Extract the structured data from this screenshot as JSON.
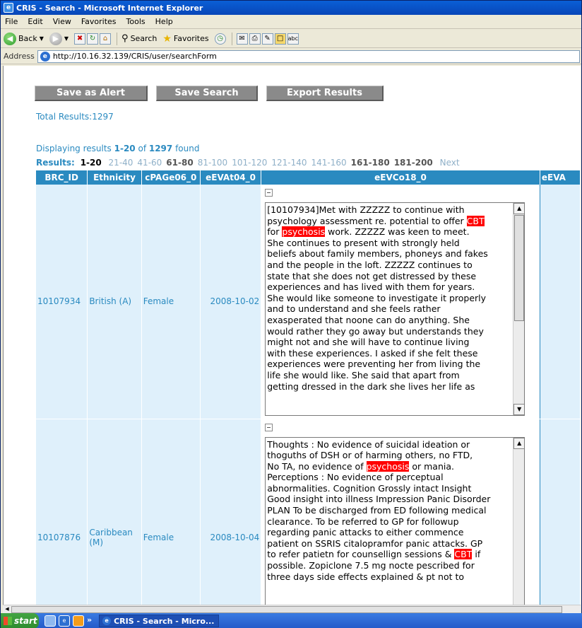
{
  "window": {
    "title": "CRIS - Search - Microsoft Internet Explorer"
  },
  "menu": [
    "File",
    "Edit",
    "View",
    "Favorites",
    "Tools",
    "Help"
  ],
  "toolbar": {
    "back": "Back",
    "search": "Search",
    "favorites": "Favorites"
  },
  "address": {
    "label": "Address",
    "url": "http://10.16.32.139/CRIS/user/searchForm"
  },
  "actions": {
    "alert": "Save as Alert",
    "save": "Save Search",
    "export": "Export Results"
  },
  "summary": {
    "total": "Total Results:1297",
    "displaying_pre": "Displaying results ",
    "displaying_range": "1-20",
    "displaying_of": " of ",
    "displaying_count": "1297",
    "displaying_post": " found"
  },
  "pager": {
    "label": "Results:",
    "current": "1-20",
    "pages": [
      "21-40",
      "41-60",
      "61-80",
      "81-100",
      "101-120",
      "121-140",
      "141-160",
      "161-180",
      "181-200"
    ],
    "visited": [
      false,
      false,
      true,
      false,
      false,
      false,
      false,
      true,
      true
    ],
    "next": "Next"
  },
  "table": {
    "headers": [
      "BRC_ID",
      "Ethnicity",
      "cPAGe06_0",
      "eEVAt04_0",
      "eEVCo18_0",
      "eEVA"
    ],
    "rows": [
      {
        "id": "10107934",
        "ethnicity": "British (A)",
        "gender": "Female",
        "date": "2008-10-02",
        "note_lines": [
          [
            {
              "t": "[10107934]Met with ZZZZZ to continue with"
            }
          ],
          [
            {
              "t": "psychology assessment re. potential to offer "
            },
            {
              "t": "CBT",
              "h": true
            }
          ],
          [
            {
              "t": "for "
            },
            {
              "t": "psychosis",
              "h": true
            },
            {
              "t": " work. ZZZZZ was keen to meet."
            }
          ],
          [
            {
              "t": "She continues to present with strongly held"
            }
          ],
          [
            {
              "t": "beliefs about family members, phoneys and fakes"
            }
          ],
          [
            {
              "t": "and the people in the loft. ZZZZZ continues to"
            }
          ],
          [
            {
              "t": "state that she does not get distressed by these"
            }
          ],
          [
            {
              "t": "experiences and has lived with them for years."
            }
          ],
          [
            {
              "t": "She would like someone to investigate it properly"
            }
          ],
          [
            {
              "t": "and to understand and she feels rather"
            }
          ],
          [
            {
              "t": "exasperated that noone can do anything. She"
            }
          ],
          [
            {
              "t": "would rather they go away but understands they"
            }
          ],
          [
            {
              "t": "might not and she will have to continue living"
            }
          ],
          [
            {
              "t": "with these experiences. I asked if she felt these"
            }
          ],
          [
            {
              "t": "experiences were preventing her from living the"
            }
          ],
          [
            {
              "t": "life she would like. She said that apart from"
            }
          ],
          [
            {
              "t": "getting dressed in the dark she lives her life as"
            }
          ]
        ]
      },
      {
        "id": "10107876",
        "ethnicity_line1": "Caribbean",
        "ethnicity_line2": "(M)",
        "gender": "Female",
        "date": "2008-10-04",
        "note_lines": [
          [
            {
              "t": "Thoughts : No evidence of suicidal ideation or"
            }
          ],
          [
            {
              "t": "thoguths of DSH or of harming others, no FTD,"
            }
          ],
          [
            {
              "t": "No TA, no evidence of "
            },
            {
              "t": "psychosis",
              "h": true
            },
            {
              "t": " or mania."
            }
          ],
          [
            {
              "t": "Perceptions : No evidence of perceptual"
            }
          ],
          [
            {
              "t": "abnormalities. Cognition Grossly intact Insight"
            }
          ],
          [
            {
              "t": "Good insight into illness Impression Panic Disorder"
            }
          ],
          [
            {
              "t": "PLAN To be discharged from ED following medical"
            }
          ],
          [
            {
              "t": "clearance. To be referred to GP for followup"
            }
          ],
          [
            {
              "t": "regarding panic attacks to either commence"
            }
          ],
          [
            {
              "t": "patient on SSRIS citalopramfor panic attacks. GP"
            }
          ],
          [
            {
              "t": "to refer patietn for counsellign sessions & "
            },
            {
              "t": "CBT",
              "h": true
            },
            {
              "t": " if"
            }
          ],
          [
            {
              "t": "possible. Zopiclone 7.5 mg nocte pescribed for"
            }
          ],
          [
            {
              "t": "three days side effects explained & pt not to"
            }
          ]
        ]
      }
    ]
  },
  "taskbar": {
    "start": "start",
    "task": "CRIS - Search - Micro..."
  }
}
